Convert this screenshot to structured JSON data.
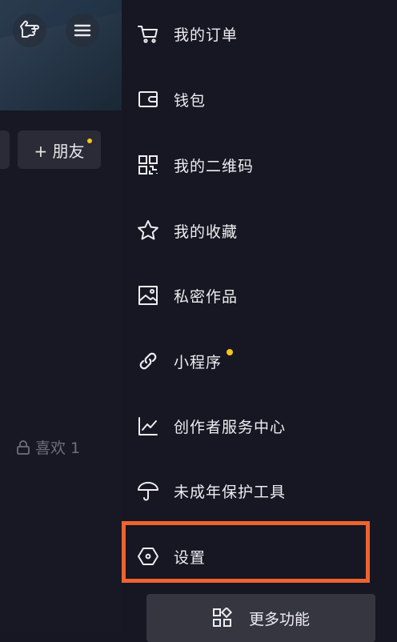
{
  "profile": {
    "add_friend_label": "+ 朋友",
    "likes_label": "喜欢 1"
  },
  "menu": {
    "items": [
      {
        "label": "我的订单",
        "icon": "cart-icon"
      },
      {
        "label": "钱包",
        "icon": "wallet-icon"
      },
      {
        "label": "我的二维码",
        "icon": "qr-code-icon"
      },
      {
        "label": "我的收藏",
        "icon": "star-icon"
      },
      {
        "label": "私密作品",
        "icon": "image-icon"
      },
      {
        "label": "小程序",
        "icon": "link-icon",
        "badge": true
      },
      {
        "label": "创作者服务中心",
        "icon": "chart-icon"
      },
      {
        "label": "未成年保护工具",
        "icon": "umbrella-icon"
      },
      {
        "label": "设置",
        "icon": "settings-icon",
        "highlighted": true
      }
    ],
    "more_label": "更多功能"
  },
  "colors": {
    "background": "#161722",
    "highlight": "#f0622f",
    "badge": "#f5c518"
  }
}
